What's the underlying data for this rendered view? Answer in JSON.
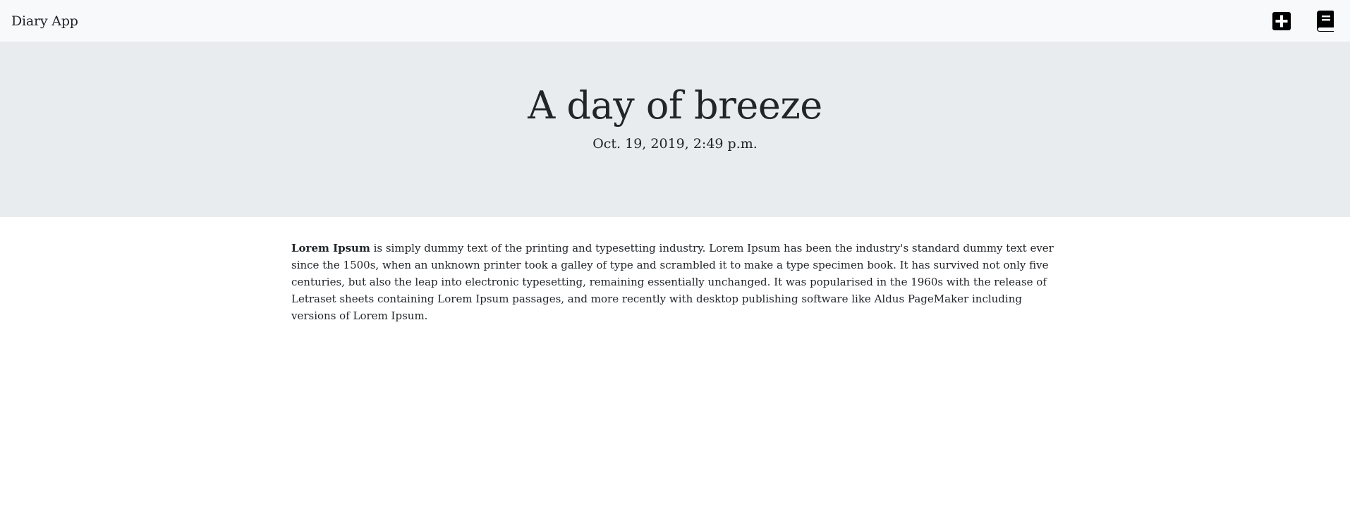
{
  "navbar": {
    "brand": "Diary App",
    "actions": [
      {
        "icon": "plus-square-icon"
      },
      {
        "icon": "book-icon"
      }
    ]
  },
  "entry": {
    "title": "A day of breeze",
    "date": "Oct. 19, 2019, 2:49 p.m.",
    "body_bold": "Lorem Ipsum",
    "body_text": " is simply dummy text of the printing and typesetting industry. Lorem Ipsum has been the industry's standard dummy text ever since the 1500s, when an unknown printer took a galley of type and scrambled it to make a type specimen book. It has survived not only five centuries, but also the leap into electronic typesetting, remaining essentially unchanged. It was popularised in the 1960s with the release of Letraset sheets containing Lorem Ipsum passages, and more recently with desktop publishing software like Aldus PageMaker including versions of Lorem Ipsum."
  },
  "colors": {
    "navbar_bg": "#f8f9fa",
    "hero_bg": "#e9ecef",
    "text": "#212529",
    "icon": "#000000"
  }
}
